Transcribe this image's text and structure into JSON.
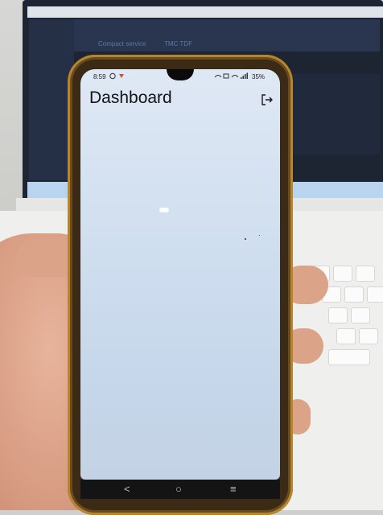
{
  "phone": {
    "status": {
      "time": "8:59",
      "battery": "35%"
    },
    "app": {
      "title": "Dashboard",
      "logout_icon": "logout-icon"
    },
    "nav": {
      "back": "<",
      "home": "○",
      "menu": "≡"
    }
  },
  "background": {
    "app_tabs": [
      "Compact service",
      "TMC TDF"
    ]
  },
  "colors": {
    "screen_bg": "#d6e3f2",
    "phone_frame": "#b6862f"
  }
}
